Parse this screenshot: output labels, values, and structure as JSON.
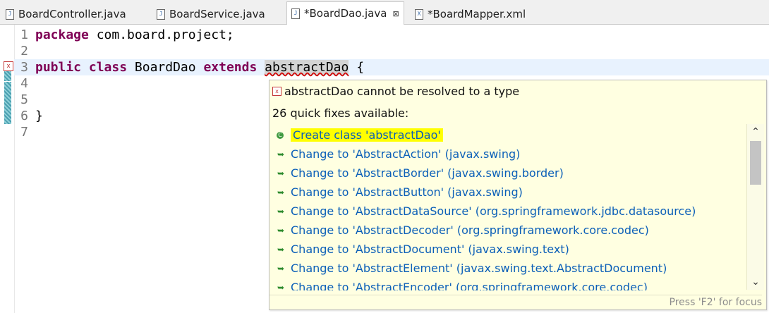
{
  "tabs": [
    {
      "label": "BoardController.java",
      "icon": "java-file-icon",
      "active": false
    },
    {
      "label": "BoardService.java",
      "icon": "java-file-icon",
      "active": false
    },
    {
      "label": "*BoardDao.java",
      "icon": "java-file-icon",
      "active": true,
      "close": "⊠"
    },
    {
      "label": "*BoardMapper.xml",
      "icon": "xml-file-icon",
      "active": false
    }
  ],
  "editor": {
    "lines": [
      {
        "num": "1",
        "tokens": [
          {
            "t": "package",
            "k": "kw"
          },
          {
            "t": " com.board.project;",
            "k": ""
          }
        ]
      },
      {
        "num": "2",
        "tokens": []
      },
      {
        "num": "3",
        "tokens": [
          {
            "t": "public",
            "k": "kw"
          },
          {
            "t": " ",
            "k": ""
          },
          {
            "t": "class",
            "k": "kw"
          },
          {
            "t": " BoardDao ",
            "k": ""
          },
          {
            "t": "extends",
            "k": "kw"
          },
          {
            "t": " ",
            "k": ""
          },
          {
            "t": "abstractDao",
            "k": "err"
          },
          {
            "t": " {",
            "k": ""
          }
        ]
      },
      {
        "num": "4",
        "tokens": []
      },
      {
        "num": "5",
        "tokens": []
      },
      {
        "num": "6",
        "tokens": [
          {
            "t": "}",
            "k": ""
          }
        ]
      },
      {
        "num": "7",
        "tokens": []
      }
    ],
    "current_line": "3"
  },
  "quickfix": {
    "problem": "abstractDao cannot be resolved to a type",
    "count_text": "26 quick fixes available:",
    "items": [
      {
        "label": "Create class 'abstractDao'",
        "icon": "create-class-icon",
        "selected": true
      },
      {
        "label": "Change to 'AbstractAction' (javax.swing)",
        "icon": "change-icon"
      },
      {
        "label": "Change to 'AbstractBorder' (javax.swing.border)",
        "icon": "change-icon"
      },
      {
        "label": "Change to 'AbstractButton' (javax.swing)",
        "icon": "change-icon"
      },
      {
        "label": "Change to 'AbstractDataSource' (org.springframework.jdbc.datasource)",
        "icon": "change-icon"
      },
      {
        "label": "Change to 'AbstractDecoder' (org.springframework.core.codec)",
        "icon": "change-icon"
      },
      {
        "label": "Change to 'AbstractDocument' (javax.swing.text)",
        "icon": "change-icon"
      },
      {
        "label": "Change to 'AbstractElement' (javax.swing.text.AbstractDocument)",
        "icon": "change-icon"
      },
      {
        "label": "Change to 'AbstractEncoder' (org.springframework.core.codec)",
        "icon": "change-icon"
      }
    ],
    "status": "Press 'F2' for focus"
  },
  "colors": {
    "keyword": "#7f0055",
    "link": "#0b5fb8",
    "popup_bg": "#ffffe1",
    "highlight": "#ffff00",
    "current_line": "#e8f2fe"
  }
}
